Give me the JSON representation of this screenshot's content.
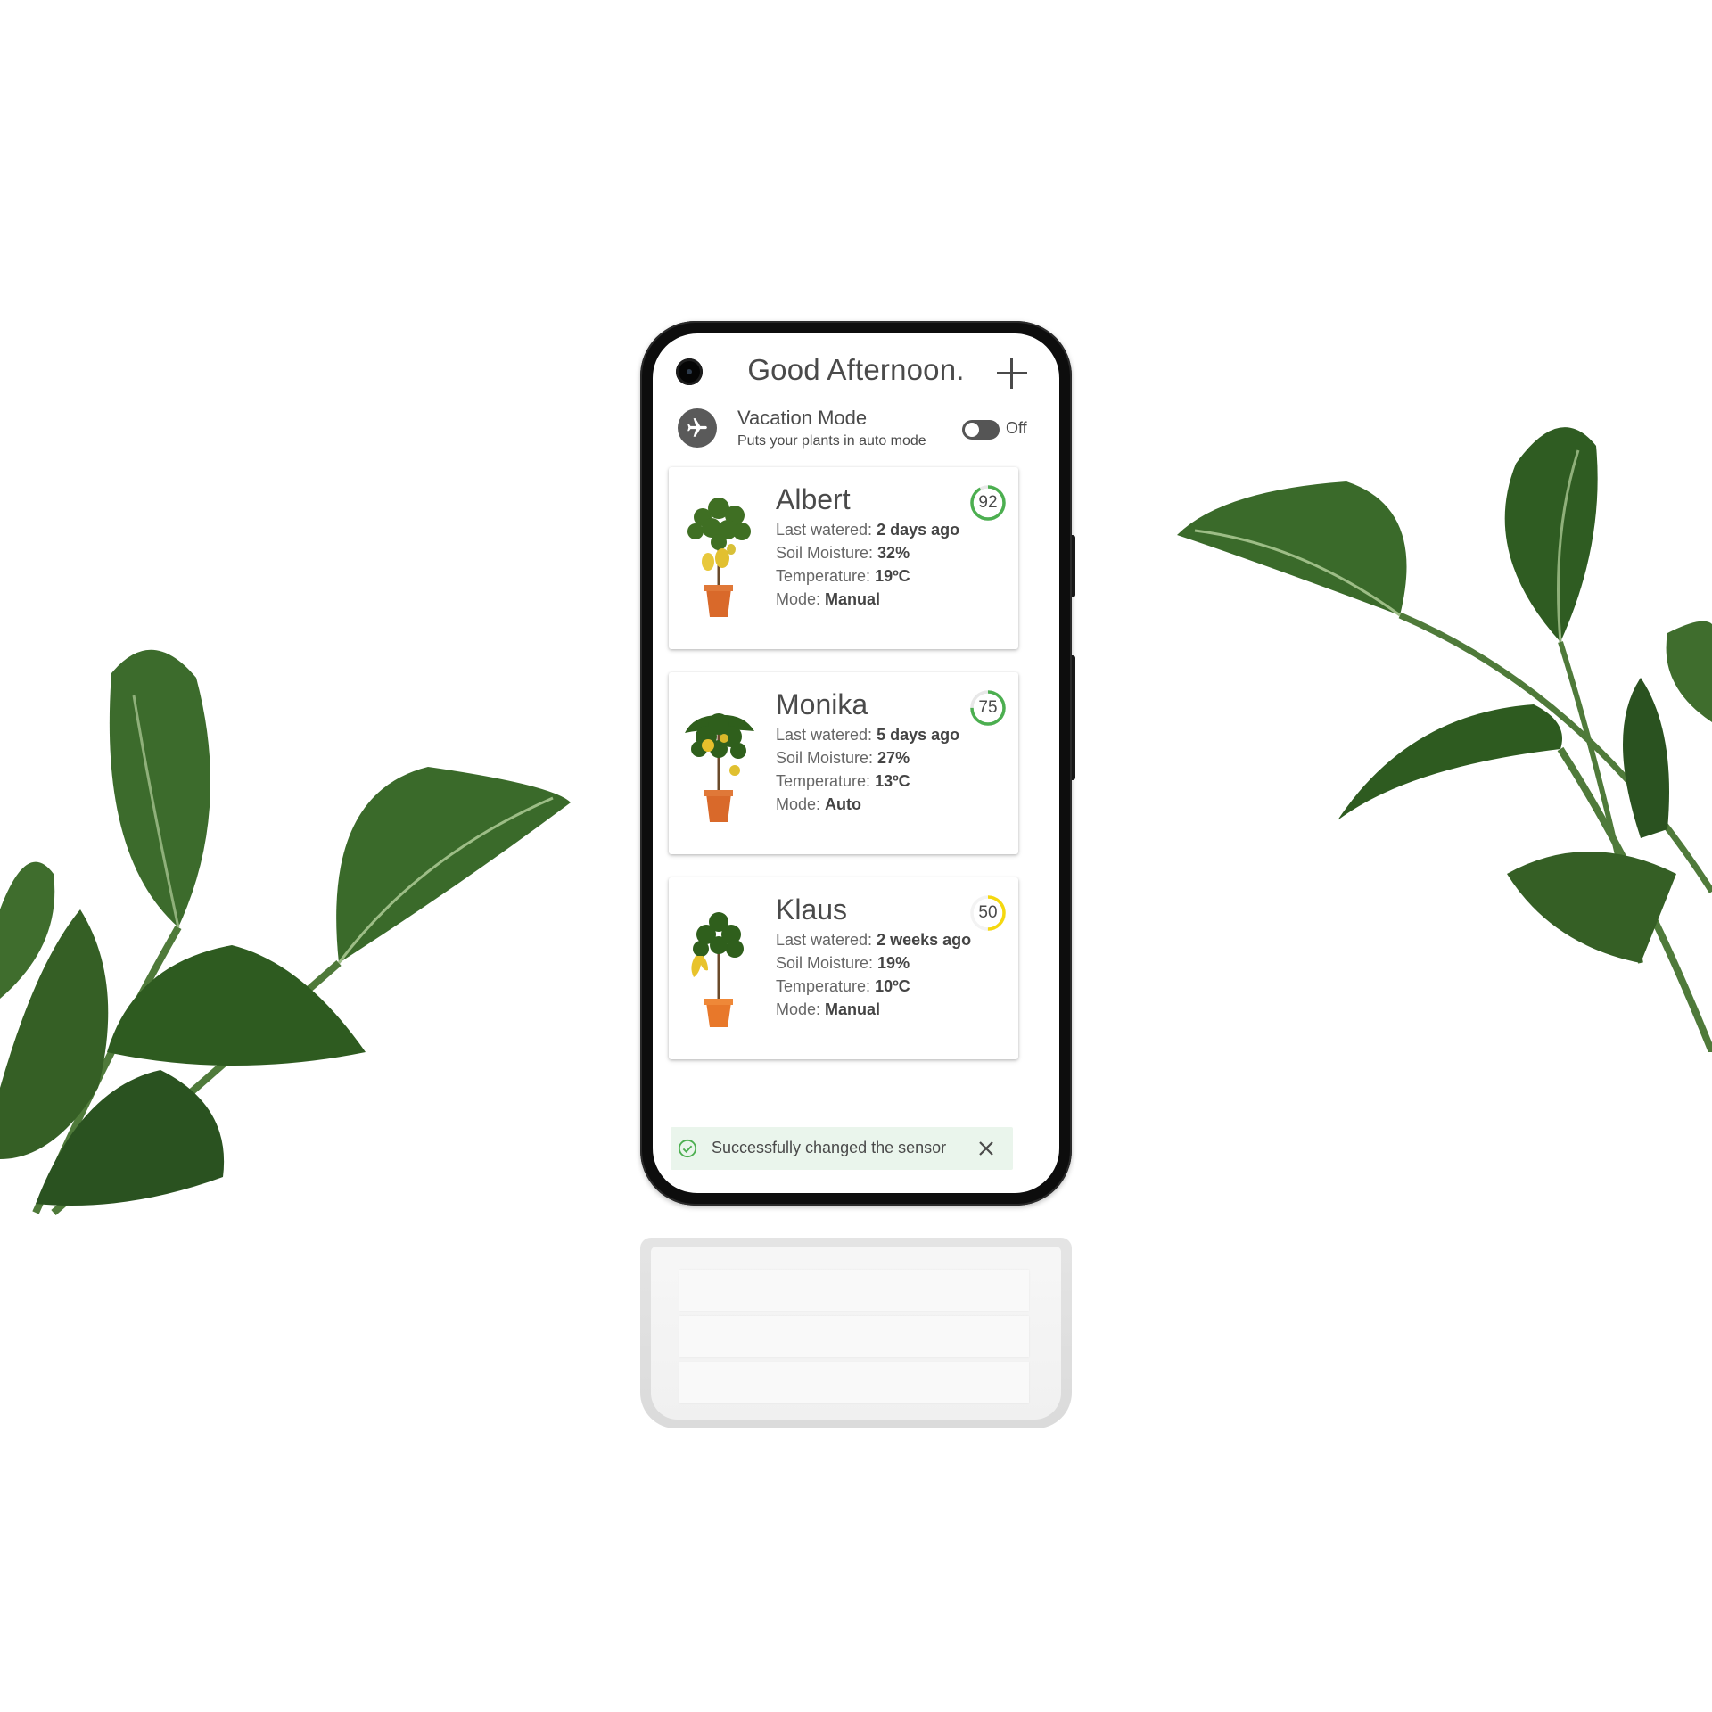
{
  "header": {
    "greeting": "Good Afternoon."
  },
  "vacation": {
    "title": "Vacation Mode",
    "subtitle": "Puts your plants in auto mode",
    "toggle_label": "Off",
    "enabled": false
  },
  "plants": [
    {
      "name": "Albert",
      "score": "92",
      "score_value": 92,
      "score_color": "#4caf50",
      "watered_label": "Last watered: ",
      "watered": "2 days ago",
      "moisture_label": "Soil Moisture: ",
      "moisture": "32%",
      "temp_label": "Temperature: ",
      "temp": "19ºC",
      "mode_label": "Mode: ",
      "mode": "Manual"
    },
    {
      "name": "Monika",
      "score": "75",
      "score_value": 75,
      "score_color": "#4caf50",
      "watered_label": "Last watered: ",
      "watered": "5 days ago",
      "moisture_label": "Soil Moisture: ",
      "moisture": "27%",
      "temp_label": "Temperature: ",
      "temp": "13ºC",
      "mode_label": "Mode: ",
      "mode": "Auto"
    },
    {
      "name": "Klaus",
      "score": "50",
      "score_value": 50,
      "score_color": "#f5d80f",
      "watered_label": "Last watered: ",
      "watered": "2 weeks ago",
      "moisture_label": "Soil Moisture: ",
      "moisture": "19%",
      "temp_label": "Temperature: ",
      "temp": "10ºC",
      "mode_label": "Mode: ",
      "mode": "Manual"
    }
  ],
  "toast": {
    "message": "Successfully changed the sensor",
    "icon": "check-circle-icon",
    "accent": "#4caf50"
  },
  "icons": {
    "add": "plus-icon",
    "vacation": "airplane-icon",
    "close": "close-icon"
  }
}
